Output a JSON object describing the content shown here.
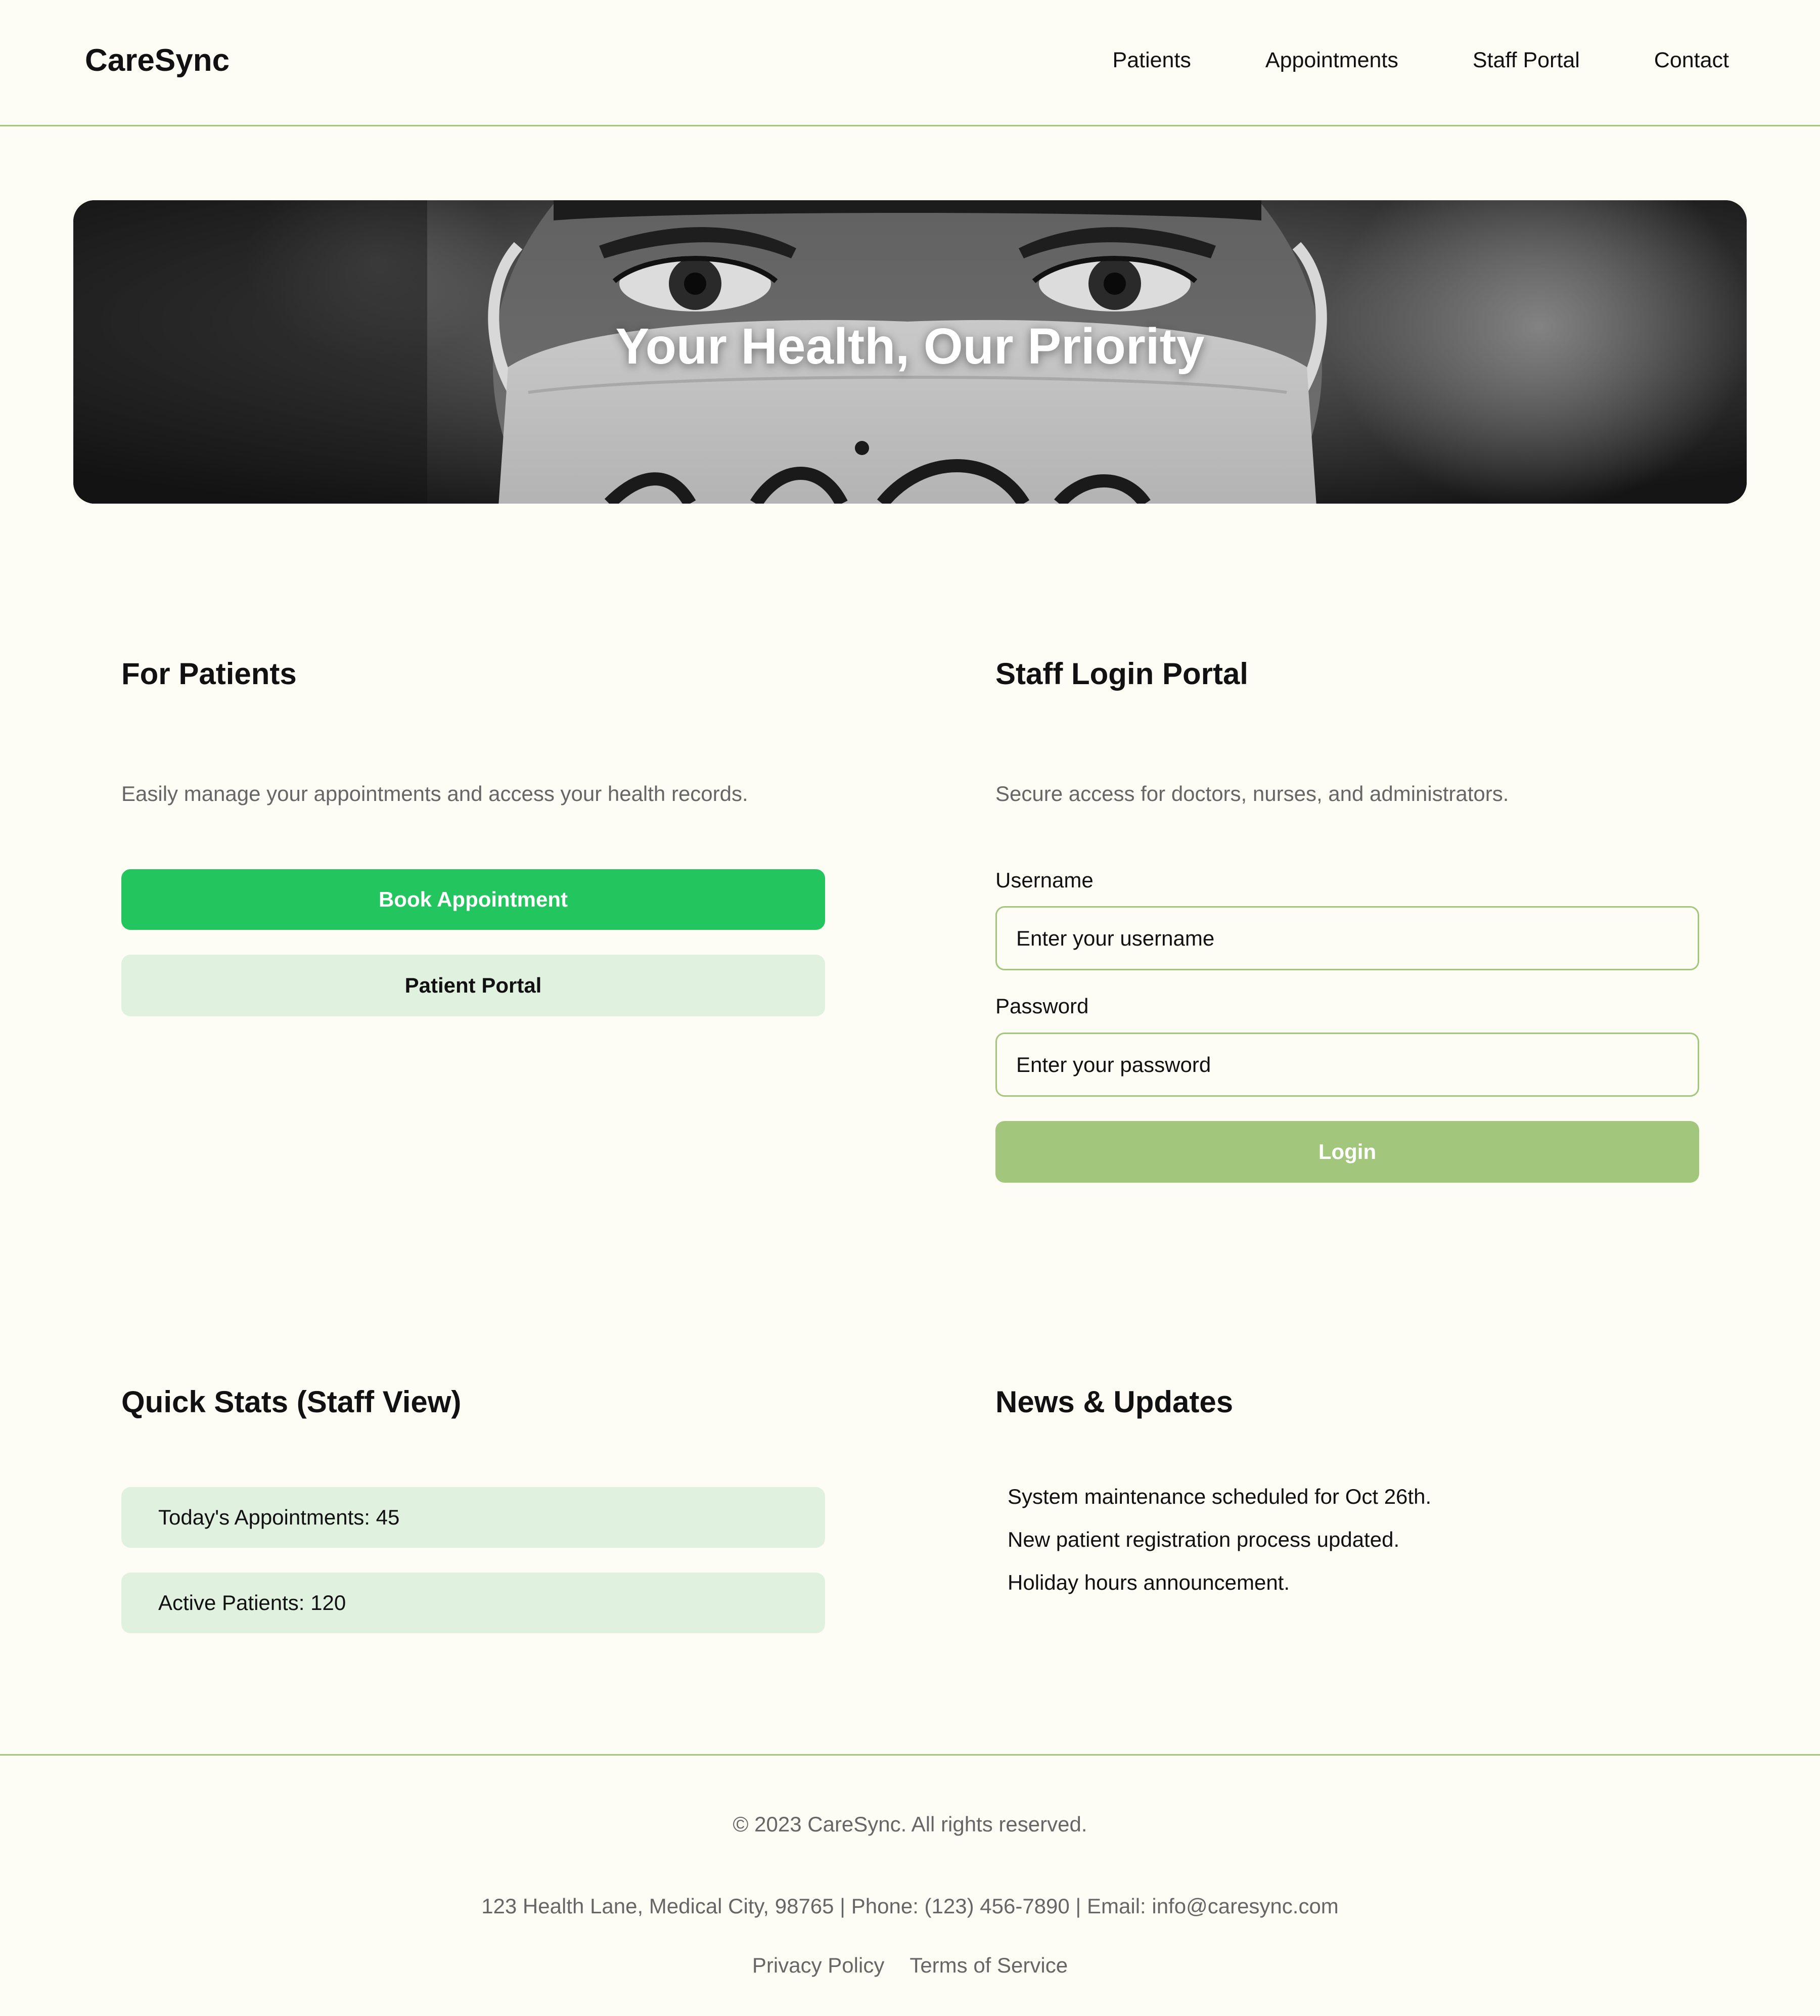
{
  "header": {
    "logo": "CareSync",
    "nav": [
      {
        "label": "Patients"
      },
      {
        "label": "Appointments"
      },
      {
        "label": "Staff Portal"
      },
      {
        "label": "Contact"
      }
    ]
  },
  "hero": {
    "title": "Your Health, Our Priority"
  },
  "patients": {
    "title": "For Patients",
    "description": "Easily manage your appointments and access your health records.",
    "book_label": "Book Appointment",
    "portal_label": "Patient Portal"
  },
  "staff_login": {
    "title": "Staff Login Portal",
    "description": "Secure access for doctors, nurses, and administrators.",
    "username_label": "Username",
    "username_placeholder": "Enter your username",
    "password_label": "Password",
    "password_placeholder": "Enter your password",
    "login_label": "Login"
  },
  "stats": {
    "title": "Quick Stats (Staff View)",
    "items": [
      {
        "text": "Today's Appointments: 45"
      },
      {
        "text": "Active Patients: 120"
      }
    ]
  },
  "news": {
    "title": "News & Updates",
    "items": [
      {
        "text": "System maintenance scheduled for Oct 26th."
      },
      {
        "text": "New patient registration process updated."
      },
      {
        "text": "Holiday hours announcement."
      }
    ]
  },
  "footer": {
    "copyright": "© 2023 CareSync. All rights reserved.",
    "contact": "123 Health Lane, Medical City, 98765 | Phone: (123) 456-7890 | Email: info@caresync.com",
    "links": [
      {
        "label": "Privacy Policy"
      },
      {
        "label": "Terms of Service"
      }
    ]
  },
  "colors": {
    "background": "#FDFDF5",
    "accent": "#A3C67D",
    "primary_button": "#22C55E",
    "light_button": "#E0F1DF",
    "muted_text": "#666666"
  }
}
